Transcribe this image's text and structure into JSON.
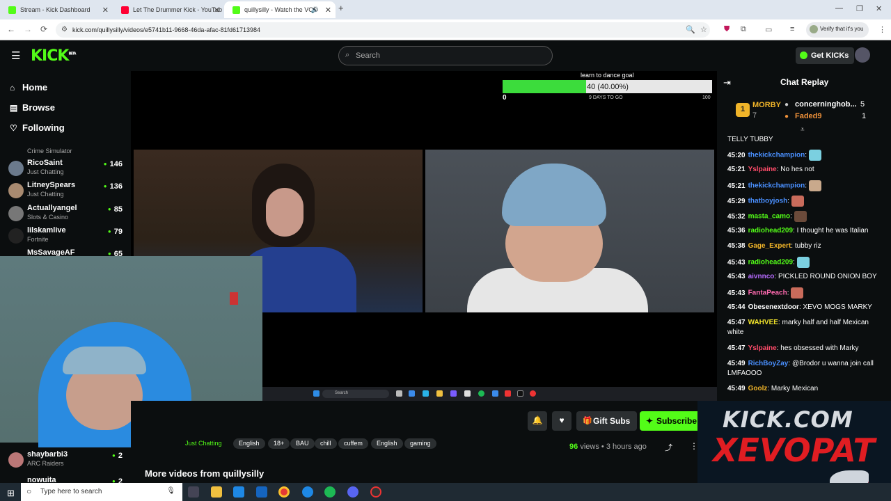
{
  "browser": {
    "tabs": [
      {
        "title": "Stream - Kick Dashboard",
        "color": "#53fc18"
      },
      {
        "title": "Let The Drummer Kick - YouTub",
        "color": "#ff0033"
      },
      {
        "title": "quillysilly - Watch the VOD",
        "color": "#53fc18"
      }
    ],
    "url": "kick.com/quillysilly/videos/e5741b11-9668-46da-afac-81fd61713984",
    "verify_label": "Verify that it's you"
  },
  "header": {
    "logo": "KICK",
    "logo_sup": "BETA",
    "search_placeholder": "Search",
    "get_kicks": "Get KICKs"
  },
  "sidebar": {
    "nav": [
      {
        "label": "Home",
        "icon": "home-icon"
      },
      {
        "label": "Browse",
        "icon": "browse-icon"
      },
      {
        "label": "Following",
        "icon": "heart-icon"
      }
    ],
    "channels": [
      {
        "name": "",
        "category": "Crime Simulator",
        "viewers": ""
      },
      {
        "name": "RicoSaint",
        "category": "Just Chatting",
        "viewers": "146"
      },
      {
        "name": "LitneySpears",
        "category": "Just Chatting",
        "viewers": "136"
      },
      {
        "name": "Actuallyangel",
        "category": "Slots & Casino",
        "viewers": "85"
      },
      {
        "name": "lilskamlive",
        "category": "Fortnite",
        "viewers": "79"
      },
      {
        "name": "MsSavageAF",
        "category": "",
        "viewers": "65"
      },
      {
        "name": "shaybarbi3",
        "category": "ARC Raiders",
        "viewers": "2"
      },
      {
        "name": "nowuita",
        "category": "",
        "viewers": "2"
      }
    ]
  },
  "goal": {
    "label": "learn to dance goal",
    "progress_text": "40 (40.00%)",
    "progress": 0.4,
    "min": "0",
    "max": "100",
    "days_left": "9 DAYS TO GO"
  },
  "inner_taskbar": {
    "search": "Search"
  },
  "video_actions": {
    "gift_subs": "Gift Subs",
    "subscribe": "Subscribe",
    "category": "Just Chatting",
    "tags": [
      "English",
      "18+",
      "BAU",
      "chill",
      "cuffem",
      "English",
      "gaming"
    ],
    "views_count": "96",
    "views_label": "views",
    "age": "3 hours ago",
    "more_videos": "More videos from quillysilly"
  },
  "chat": {
    "title": "Chat Replay",
    "leaders": [
      {
        "name": "MORBY",
        "count": "7",
        "color": "#f0b429"
      },
      {
        "name": "concerninghob...",
        "count": "5",
        "color": "#ffffff"
      },
      {
        "name": "Faded9",
        "count": "1",
        "color": "#f0923b"
      }
    ],
    "top_line": "TELLY TUBBY",
    "messages": [
      {
        "time": "45:20",
        "user": "thekickchampion",
        "color": "#4a90ff",
        "text": ""
      },
      {
        "time": "45:21",
        "user": "Yslpaine",
        "color": "#ff4c6a",
        "text": "No hes not"
      },
      {
        "time": "45:21",
        "user": "thekickchampion",
        "color": "#4a90ff",
        "text": ""
      },
      {
        "time": "45:29",
        "user": "thatboyjosh",
        "color": "#4a90ff",
        "text": ""
      },
      {
        "time": "45:32",
        "user": "masta_camo",
        "color": "#53fc18",
        "text": ""
      },
      {
        "time": "45:36",
        "user": "radiohead209",
        "color": "#53fc18",
        "text": "I thought he was Italian"
      },
      {
        "time": "45:38",
        "user": "Gage_Expert",
        "color": "#f0b429",
        "text": "tubby riz"
      },
      {
        "time": "45:43",
        "user": "radiohead209",
        "color": "#53fc18",
        "text": ""
      },
      {
        "time": "45:43",
        "user": "aivnnco",
        "color": "#b76bff",
        "text": "PICKLED ROUND ONION BOY"
      },
      {
        "time": "45:43",
        "user": "FantaPeach",
        "color": "#ff6ab0",
        "text": ""
      },
      {
        "time": "45:44",
        "user": "Obesenextdoor",
        "color": "#ffffff",
        "text": "XEVO MOGS MARKY"
      },
      {
        "time": "45:47",
        "user": "WAHVEE",
        "color": "#f0e22b",
        "text": "marky half and half Mexican white"
      },
      {
        "time": "45:47",
        "user": "Yslpaine",
        "color": "#ff4c6a",
        "text": "hes obsessed with Marky"
      },
      {
        "time": "45:49",
        "user": "RichBoyZay",
        "color": "#4a90ff",
        "text": "@Brodor u wanna join call LMFAOOO"
      },
      {
        "time": "45:49",
        "user": "Goolz",
        "color": "#f0b429",
        "text": "Marky Mexican"
      }
    ]
  },
  "overlay": {
    "line1": "KICK.COM",
    "line2": "XEVOPAT"
  },
  "windows_taskbar": {
    "search_placeholder": "Type here to search"
  }
}
